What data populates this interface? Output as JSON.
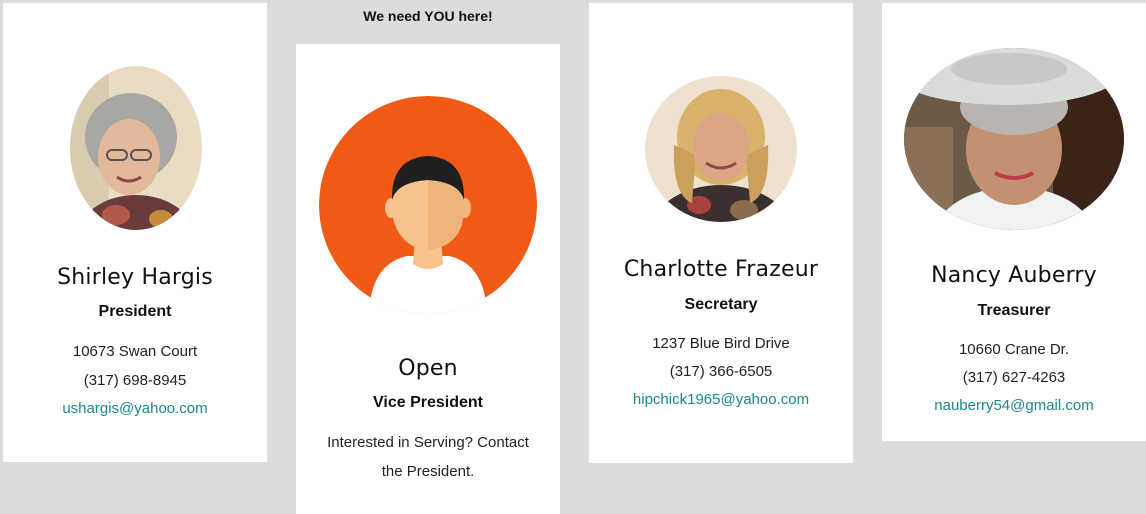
{
  "banner": "We need YOU here!",
  "officers": [
    {
      "name": "Shirley Hargis",
      "role": "President",
      "address": "10673 Swan Court",
      "phone": "(317) 698-8945",
      "email": "ushargis@yahoo.com"
    },
    {
      "name": "Open",
      "role": "Vice President",
      "note_line1": "Interested in Serving?  Contact",
      "note_line2": "the President."
    },
    {
      "name": "Charlotte Frazeur",
      "role": "Secretary",
      "address": "1237 Blue Bird Drive",
      "phone": "(317) 366-6505",
      "email": "hipchick1965@yahoo.com"
    },
    {
      "name": "Nancy Auberry",
      "role": "Treasurer",
      "address": "10660 Crane Dr.",
      "phone": "(317) 627-4263",
      "email": "nauberry54@gmail.com"
    }
  ],
  "colors": {
    "background": "#dedcdb",
    "card": "#ffffff",
    "link": "#1a8a85",
    "avatar_orange": "#f05a14"
  }
}
